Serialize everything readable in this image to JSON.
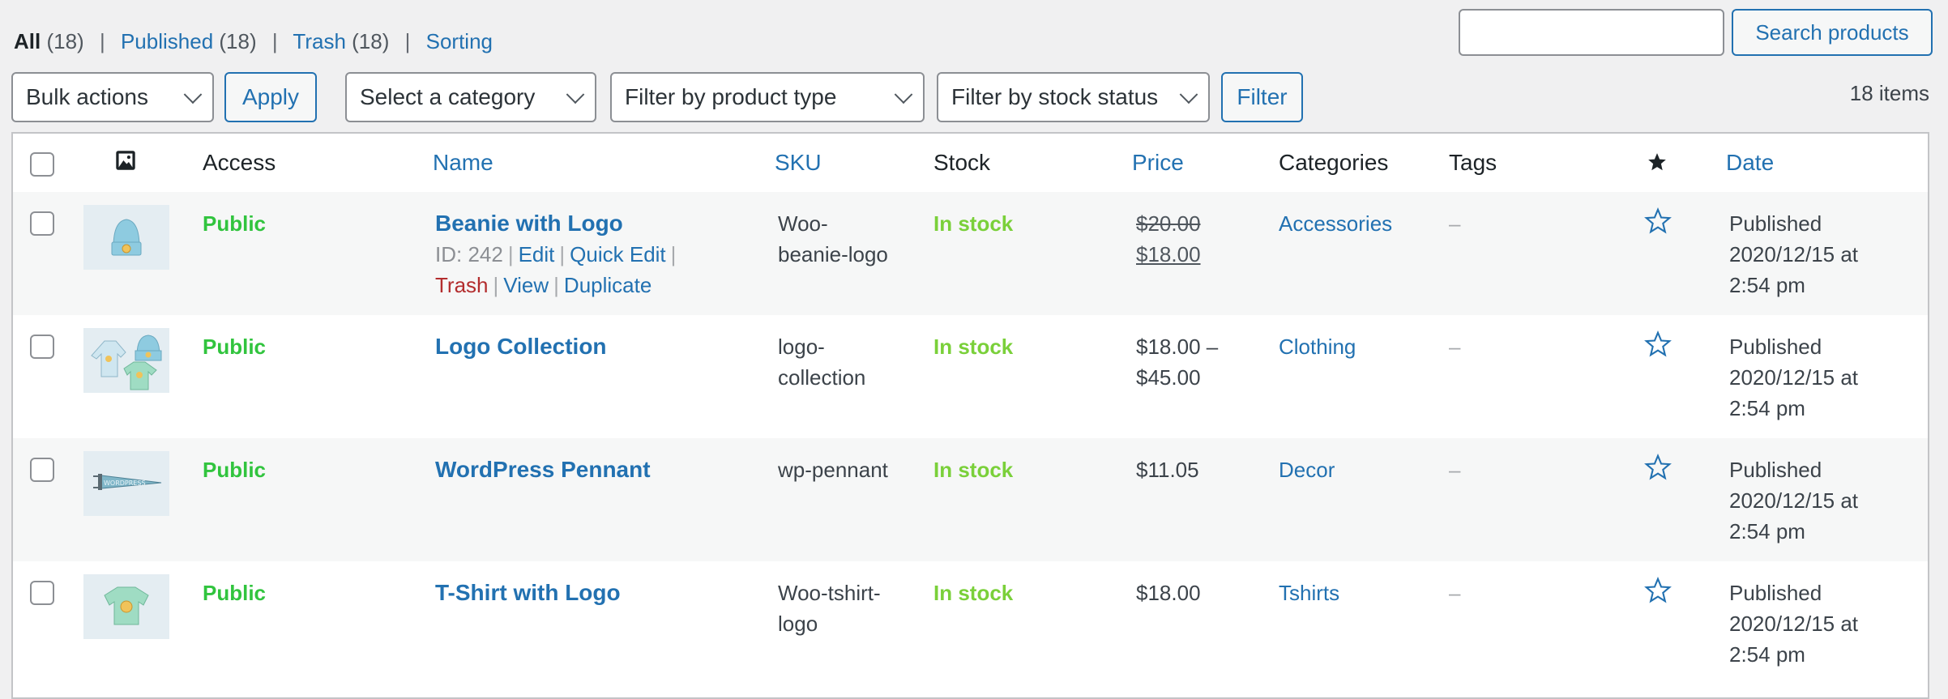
{
  "views": [
    {
      "label": "All",
      "count": "(18)",
      "current": true
    },
    {
      "label": "Published",
      "count": "(18)",
      "current": false
    },
    {
      "label": "Trash",
      "count": "(18)",
      "current": false
    },
    {
      "label": "Sorting",
      "count": "",
      "current": false
    }
  ],
  "search": {
    "value": "",
    "placeholder": "",
    "button_label": "Search products"
  },
  "toolbar": {
    "bulk_actions": "Bulk actions",
    "apply_label": "Apply",
    "category_select": "Select a category",
    "product_type_select": "Filter by product type",
    "stock_status_select": "Filter by stock status",
    "filter_label": "Filter",
    "items_count": "18 items"
  },
  "columns": {
    "image_icon": "image-icon",
    "access": "Access",
    "name": "Name",
    "sku": "SKU",
    "stock": "Stock",
    "price": "Price",
    "categories": "Categories",
    "tags": "Tags",
    "featured_icon": "star-filled-icon",
    "date": "Date"
  },
  "colors": {
    "link": "#2271b1",
    "public": "#31c43e",
    "in_stock": "#7ad03a",
    "trash": "#b32d2e"
  },
  "rows": [
    {
      "thumbnail": "beanie-thumbnail",
      "access": "Public",
      "name": "Beanie with Logo",
      "id_label": "ID: 242",
      "actions": {
        "edit": "Edit",
        "quick_edit": "Quick Edit",
        "trash": "Trash",
        "view": "View",
        "duplicate": "Duplicate"
      },
      "sku_line1": "Woo-",
      "sku_line2": "beanie-logo",
      "stock": "In stock",
      "price_regular": "$20.00",
      "price_sale": "$18.00",
      "category": "Accessories",
      "tags": "–",
      "featured": false,
      "date_status": "Published",
      "date_line": "2020/12/15 at",
      "date_time": "2:54 pm"
    },
    {
      "thumbnail": "logo-collection-thumbnail",
      "access": "Public",
      "name": "Logo Collection",
      "sku_line1": "logo-",
      "sku_line2": "collection",
      "stock": "In stock",
      "price_line1": "$18.00 –",
      "price_line2": "$45.00",
      "category": "Clothing",
      "tags": "–",
      "featured": false,
      "date_status": "Published",
      "date_line": "2020/12/15 at",
      "date_time": "2:54 pm"
    },
    {
      "thumbnail": "pennant-thumbnail",
      "access": "Public",
      "name": "WordPress Pennant",
      "sku_line1": "wp-pennant",
      "sku_line2": "",
      "stock": "In stock",
      "price_line1": "$11.05",
      "price_line2": "",
      "category": "Decor",
      "tags": "–",
      "featured": false,
      "date_status": "Published",
      "date_line": "2020/12/15 at",
      "date_time": "2:54 pm"
    },
    {
      "thumbnail": "tshirt-thumbnail",
      "access": "Public",
      "name": "T-Shirt with Logo",
      "sku_line1": "Woo-tshirt-",
      "sku_line2": "logo",
      "stock": "In stock",
      "price_line1": "$18.00",
      "price_line2": "",
      "category": "Tshirts",
      "tags": "–",
      "featured": false,
      "date_status": "Published",
      "date_line": "2020/12/15 at",
      "date_time": "2:54 pm"
    }
  ]
}
